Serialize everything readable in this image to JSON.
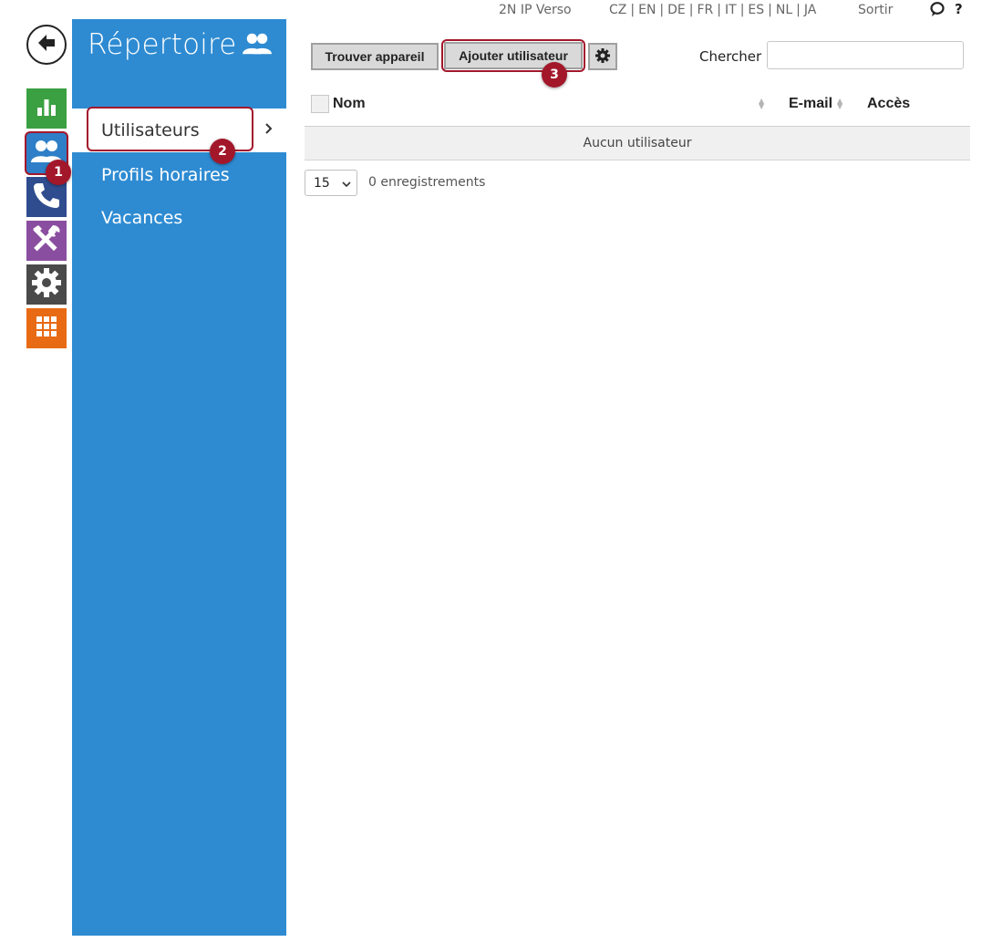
{
  "topbar": {
    "device_name": "2N IP Verso",
    "languages": [
      "CZ",
      "EN",
      "DE",
      "FR",
      "IT",
      "ES",
      "NL",
      "JA"
    ],
    "logout_label": "Sortir",
    "help_label": "?"
  },
  "nav_icons": [
    "back-arrow-icon",
    "bar-chart-icon",
    "users-icon",
    "phone-icon",
    "tools-icon",
    "gear-icon",
    "grid-icon"
  ],
  "sidebar": {
    "title": "Répertoire",
    "items": [
      {
        "label": "Utilisateurs",
        "active": true
      },
      {
        "label": "Profils horaires"
      },
      {
        "label": "Vacances"
      }
    ]
  },
  "toolbar": {
    "find_device_label": "Trouver appareil",
    "add_user_label": "Ajouter utilisateur",
    "search_label": "Chercher",
    "search_value": "",
    "search_placeholder": ""
  },
  "table": {
    "columns": [
      "Nom",
      "E-mail",
      "Accès"
    ],
    "empty_message": "Aucun utilisateur"
  },
  "pagination": {
    "page_size": "15",
    "records_text": "0 enregistrements"
  },
  "annotations": [
    "1",
    "2",
    "3"
  ],
  "colors": {
    "sidebar_bg": "#2e8bd2",
    "highlight": "#a3172b",
    "stats_icon": "#3aa041",
    "directory_icon": "#2e7fc7",
    "calls_icon": "#2f4c8f",
    "tools_icon": "#8a4ea0",
    "settings_icon": "#4a4a4a",
    "apps_icon": "#e86a14"
  }
}
